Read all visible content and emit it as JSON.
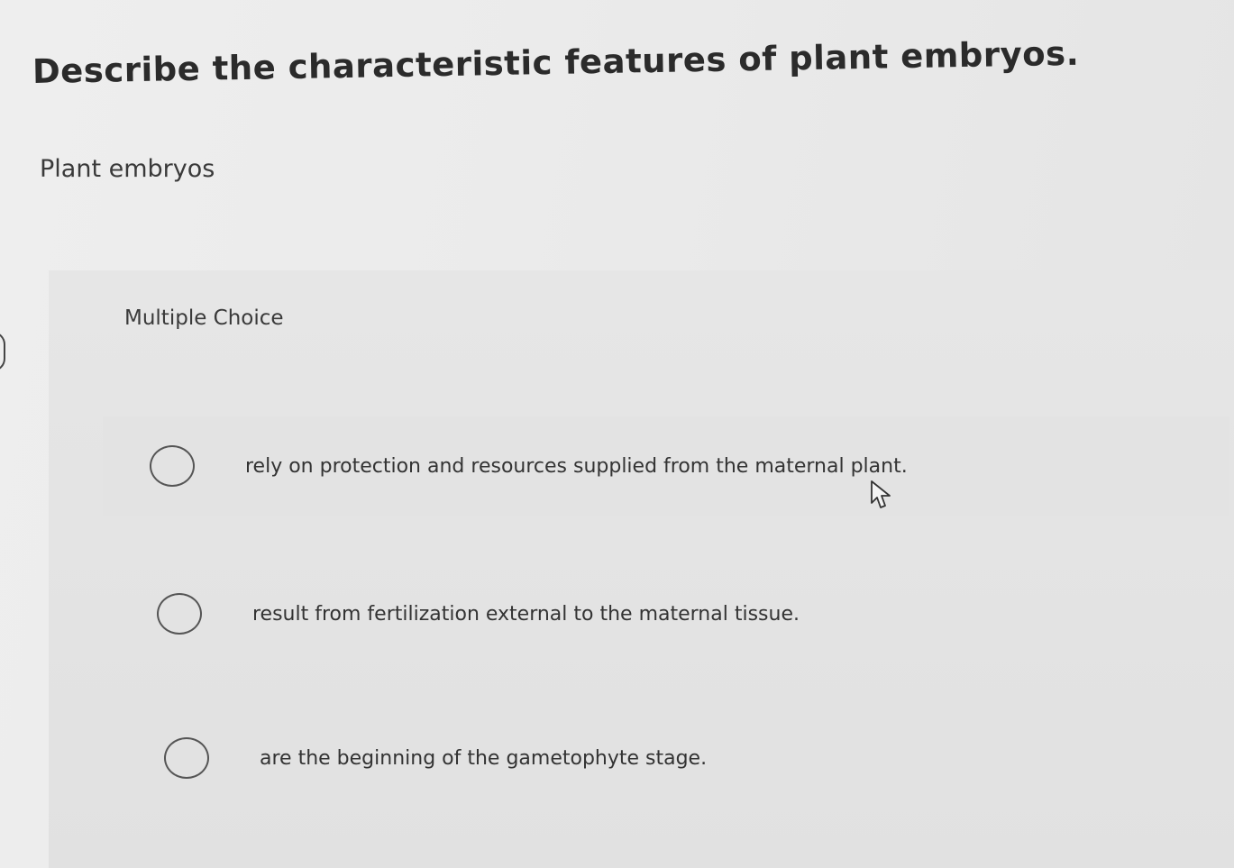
{
  "question": {
    "title": "Describe the characteristic features of plant embryos.",
    "prompt": "Plant embryos"
  },
  "choices": {
    "type_label": "Multiple Choice",
    "options": [
      {
        "label": "rely on protection and resources supplied from the maternal plant."
      },
      {
        "label": "result from fertilization external to the maternal tissue."
      },
      {
        "label": "are the beginning of the gametophyte stage."
      }
    ]
  },
  "icons": {
    "radio": "radio-circle-icon",
    "cursor": "mouse-pointer-icon"
  }
}
